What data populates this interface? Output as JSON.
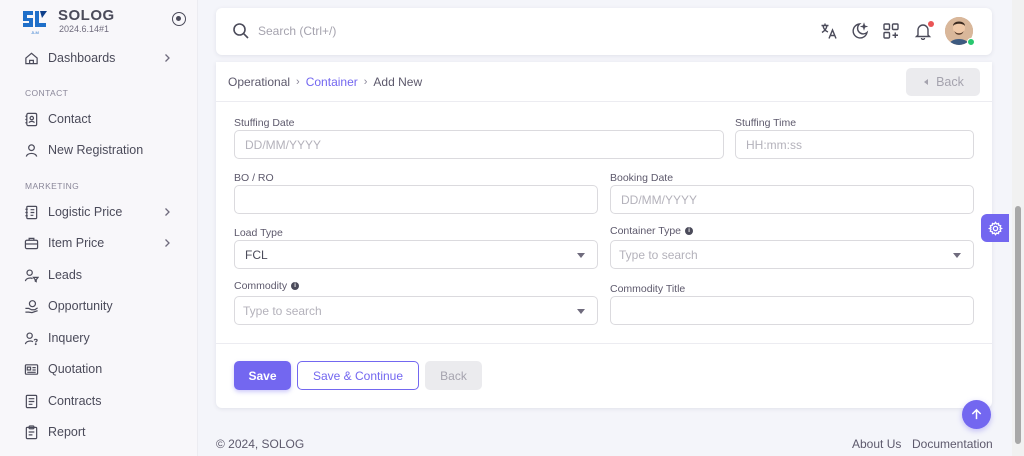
{
  "brand": {
    "name": "SOLOG",
    "version": "2024.6.14#1",
    "logo_sub": "JLM",
    "color": "#1f6fc9"
  },
  "sidebar": {
    "dashboards": "Dashboards",
    "section_contact": "CONTACT",
    "contact": "Contact",
    "new_registration": "New Registration",
    "section_marketing": "MARKETING",
    "logistic_price": "Logistic Price",
    "item_price": "Item Price",
    "leads": "Leads",
    "opportunity": "Opportunity",
    "inquery": "Inquery",
    "quotation": "Quotation",
    "contracts": "Contracts",
    "report": "Report"
  },
  "topbar": {
    "search_placeholder": "Search (Ctrl+/)"
  },
  "breadcrumb": {
    "level1": "Operational",
    "level2": "Container",
    "level3": "Add New"
  },
  "header_back": "Back",
  "form": {
    "stuffing_date_label": "Stuffing Date",
    "stuffing_date_placeholder": "DD/MM/YYYY",
    "stuffing_time_label": "Stuffing Time",
    "stuffing_time_placeholder": "HH:mm:ss",
    "bo_ro_label": "BO / RO",
    "booking_date_label": "Booking Date",
    "booking_date_placeholder": "DD/MM/YYYY",
    "load_type_label": "Load Type",
    "load_type_value": "FCL",
    "container_type_label": "Container Type",
    "container_type_placeholder": "Type to search",
    "commodity_label": "Commodity",
    "commodity_placeholder": "Type to search",
    "commodity_title_label": "Commodity Title"
  },
  "buttons": {
    "save": "Save",
    "save_continue": "Save & Continue",
    "back": "Back"
  },
  "footer": {
    "copyright": "© 2024, SOLOG",
    "about": "About Us",
    "docs": "Documentation"
  },
  "colors": {
    "primary": "#7367f0",
    "notification": "#ea5455",
    "online": "#28c76f"
  }
}
